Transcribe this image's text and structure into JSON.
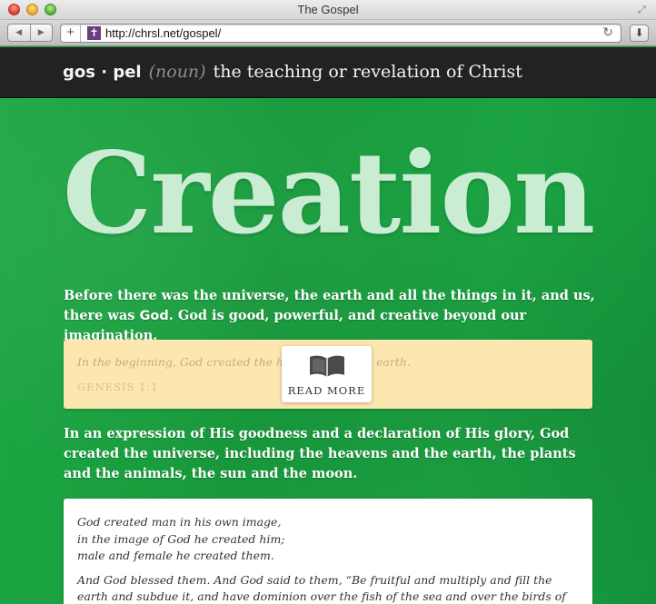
{
  "window": {
    "title": "The Gospel"
  },
  "toolbar": {
    "url": "http://chrsl.net/gospel/",
    "favicon_glyph": "✝",
    "back_icon": "back-arrow-icon",
    "forward_icon": "forward-arrow-icon"
  },
  "header": {
    "word": "gos · pel",
    "part_of_speech": "(noun)",
    "definition": "the teaching or revelation of Christ"
  },
  "hero": {
    "title": "Creation"
  },
  "intro": {
    "before": "Before there was the universe, the earth and all the things in it, and us, there was ",
    "emphasis": "God",
    "after": ". God is good, powerful, and creative beyond our imagination."
  },
  "scripture": {
    "quote_start": "In the beginning, God created the he",
    "quote_end": "earth.",
    "reference": "GENESIS 1:1",
    "read_more_label": "READ MORE"
  },
  "paragraph2": "In an expression of His goodness and a declaration of His glory, God created the universe, including the heavens and the earth, the plants and the animals, the sun and the moon.",
  "verse": {
    "lines": [
      "God created man in his own image,",
      "in the image of God he created him;",
      "male and female he created them."
    ],
    "paragraph": "And God blessed them. And God said to them, “Be fruitful and multiply and fill the earth and subdue it, and have dominion over the fish of the sea and over the birds of"
  },
  "colors": {
    "header_bg": "#222222",
    "page_green": "#1a9e3f",
    "hero_text": "#c9ecd3",
    "scripture_bg": "#fde7b0"
  }
}
